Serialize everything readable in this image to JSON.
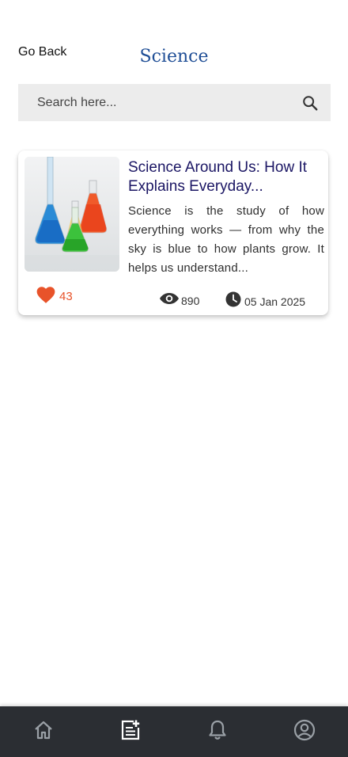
{
  "header": {
    "back_label": "Go Back",
    "title": "Science"
  },
  "search": {
    "placeholder": "Search here...",
    "icon": "search-icon"
  },
  "articles": [
    {
      "image_icon": "lab-flasks-image",
      "title": "Science Around Us: How It Explains Everyday...",
      "excerpt": "Science is the study of how everything works — from why the sky is blue to how plants grow. It helps us understand...",
      "likes": "43",
      "views": "890",
      "date": "05 Jan 2025"
    }
  ],
  "bottom_nav": {
    "items": [
      "home-icon",
      "articles-icon",
      "notifications-icon",
      "profile-icon"
    ],
    "active": "articles-icon"
  },
  "colors": {
    "title_blue": "#1f4e96",
    "card_title": "#1b1664",
    "like_red": "#e8532a",
    "nav_bg": "#2b2e33",
    "nav_icon": "#9aa0a6",
    "nav_active": "#ffffff"
  }
}
